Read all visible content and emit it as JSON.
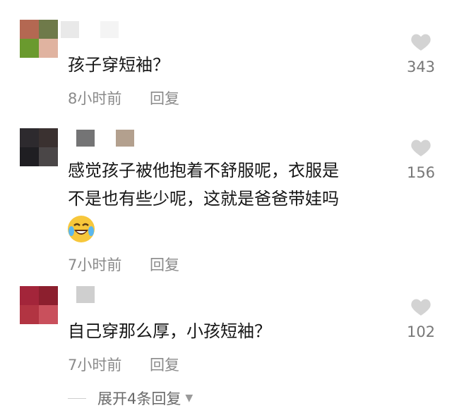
{
  "comments": [
    {
      "text": "孩子穿短袖？",
      "time": "8小时前",
      "reply_label": "回复",
      "likes": "343",
      "avatar_colors": [
        "#b46852",
        "#6f7a4a",
        "#6a9a2e",
        "#e0b3a0"
      ],
      "username_colors": [
        "#e9e9e9",
        "#f4f4f4"
      ]
    },
    {
      "text": "感觉孩子被他抱着不舒服呢，衣服是\n不是也有些少呢，这就是爸爸带娃吗",
      "time": "7小时前",
      "reply_label": "回复",
      "likes": "156",
      "avatar_colors": [
        "#2d2a2e",
        "#3a3130",
        "#1f1e22",
        "#4a4647"
      ],
      "username_colors": [
        "#747475",
        "#b3a08e"
      ],
      "emoji": "laughing-tears-emoji"
    },
    {
      "text": "自己穿那么厚，小孩短袖？",
      "time": "7小时前",
      "reply_label": "回复",
      "likes": "102",
      "avatar_colors": [
        "#a3253a",
        "#8c1f2e",
        "#b23442",
        "#c9505c"
      ],
      "username_colors": [
        "#cfcfcf"
      ]
    }
  ],
  "expand_replies": "展开4条回复",
  "icons": {
    "like": "heart-icon",
    "expand": "caret-down-icon"
  },
  "colors": {
    "heart": "#d3d3d3",
    "text": "#161616",
    "meta": "#8a8a8a"
  }
}
